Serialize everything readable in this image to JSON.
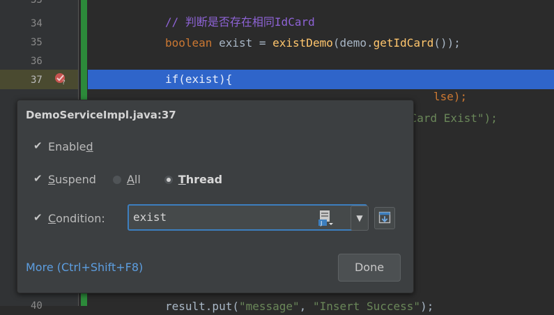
{
  "editor": {
    "line_numbers": [
      "33",
      "34",
      "35",
      "36",
      "37",
      "40"
    ],
    "comment_prefix": "// ",
    "comment_zh": "判断是否存在相同",
    "comment_id": "IdCard",
    "line35": {
      "kw": "boolean",
      "mid": " exist = ",
      "fn": "existDemo",
      "arg": "(demo.",
      "getter": "getIdCard",
      "end": "());"
    },
    "line37": "if(exist){",
    "line38_visible": {
      "pre": "       ",
      "tail": "lse);"
    },
    "line39_visible": {
      "tail": "dCard Exist\");"
    },
    "line40_visible": {
      "pre": "result.put(",
      "str1": "\"message\"",
      "mid": ", ",
      "str2": "\"Insert Success\"",
      "end": ");"
    }
  },
  "popup": {
    "title": "DemoServiceImpl.java:37",
    "enabled": {
      "pre": "Enable",
      "u": "d",
      "post": "",
      "checked": true
    },
    "suspend": {
      "pre": "",
      "u": "S",
      "post": "uspend",
      "checked": true
    },
    "radio_all": {
      "u": "A",
      "post": "ll",
      "selected": false
    },
    "radio_thread": {
      "pre": "",
      "u": "T",
      "post": "hread",
      "selected": true
    },
    "condition": {
      "pre": "",
      "u": "C",
      "post": "ondition:",
      "checked": true,
      "value": "exist"
    },
    "dropdown_glyph": "▼",
    "more_link": "More (Ctrl+Shift+F8)",
    "done_label": "Done"
  },
  "colors": {
    "selection": "#2f65ca",
    "change_marker": "#2c8a3a",
    "link": "#5d9ee0",
    "keyword": "#cc7832",
    "method": "#ffc66d",
    "string": "#6a8759",
    "comment": "#8e63d6"
  }
}
